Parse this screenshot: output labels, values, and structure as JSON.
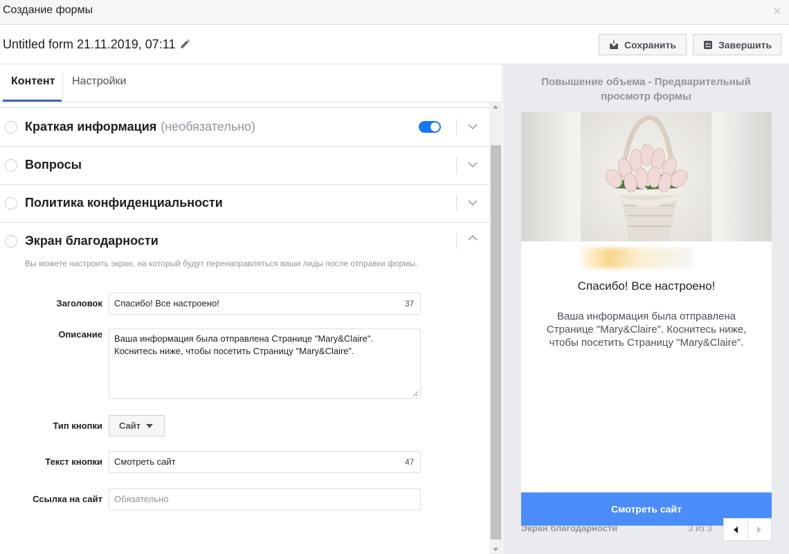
{
  "window": {
    "title": "Создание формы",
    "close_glyph": "×",
    "close_icon": "close-icon"
  },
  "header": {
    "form_name": "Untitled form 21.11.2019, 07:11",
    "edit_icon": "pencil-icon",
    "save_label": "Сохранить",
    "save_icon": "download-tray-icon",
    "finish_label": "Завершить",
    "finish_icon": "checklist-icon"
  },
  "tabs": [
    {
      "label": "Контент",
      "active": true
    },
    {
      "label": "Настройки",
      "active": false
    }
  ],
  "sections": [
    {
      "title": "Краткая информация",
      "optional_note": "(необязательно)",
      "toggle_on": true,
      "expanded": false
    },
    {
      "title": "Вопросы",
      "expanded": false
    },
    {
      "title": "Политика конфиденциальности",
      "expanded": false
    },
    {
      "title": "Экран благодарности",
      "expanded": true
    }
  ],
  "thank_you": {
    "description": "Вы можете настроить экран, на который будут перенаправляться ваши лиды после отправки формы.",
    "headline_label": "Заголовок",
    "headline_value": "Спасибо! Все настроено!",
    "headline_counter": "37",
    "description_label": "Описание",
    "description_value": "Ваша информация была отправлена Странице \"Mary&Claire\". Коснитесь ниже, чтобы посетить Страницу \"Mary&Claire\".",
    "button_type_label": "Тип кнопки",
    "button_type_value": "Сайт",
    "button_text_label": "Текст кнопки",
    "button_text_value": "Смотреть сайт",
    "button_text_counter": "47",
    "website_link_label": "Ссылка на сайт",
    "website_link_placeholder": "Обязательно"
  },
  "preview": {
    "title": "Повышение объема - Предварительный просмотр формы",
    "thanks_headline": "Спасибо! Все настроено!",
    "thanks_description": "Ваша информация была отправлена Странице \"Mary&Claire\". Коснитесь ниже, чтобы посетить Страницу \"Mary&Claire\".",
    "cta_label": "Смотреть сайт",
    "footer_label": "Экран благодарности",
    "page_indicator": "3 из 3"
  },
  "colors": {
    "accent": "#4267b2",
    "toggle": "#1877f2",
    "cta": "#4a8df8",
    "panel_bg": "#e9ebee"
  }
}
